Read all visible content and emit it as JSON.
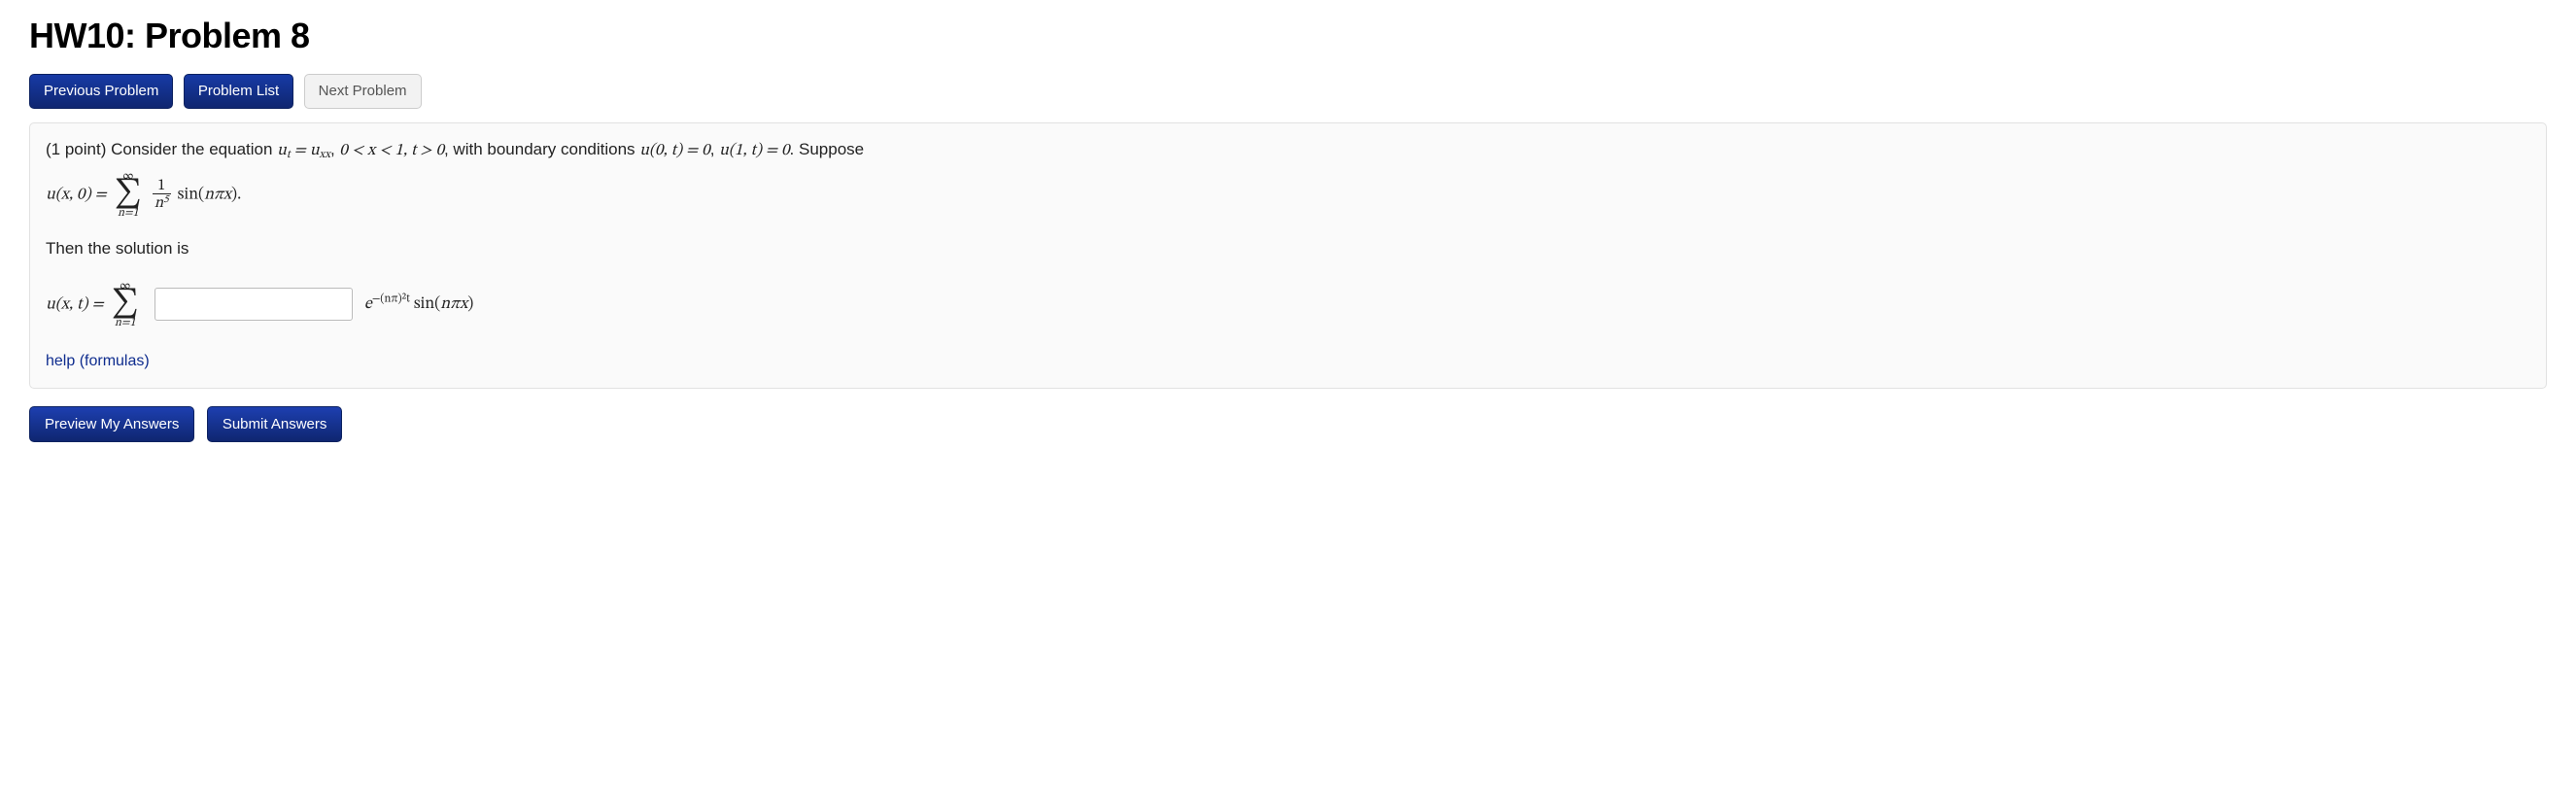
{
  "header": {
    "title": "HW10: Problem 8"
  },
  "nav": {
    "prev": "Previous Problem",
    "list": "Problem List",
    "next": "Next Problem"
  },
  "problem": {
    "points_prefix": "(1 point) ",
    "intro1": "Consider the equation ",
    "eq_pde": "uₜ = uₓₓ",
    "eq_comma": ", ",
    "domain": "0 < x < 1, t > 0",
    "intro2": ", with boundary conditions ",
    "bc1": "u(0, t) = 0",
    "bc_sep": ", ",
    "bc2": "u(1, t) = 0",
    "intro3": ". Suppose",
    "ic_lhs": "u(x, 0) = ",
    "sum_top": "∞",
    "sum_bottom": "n=1",
    "frac_num": "1",
    "frac_den": "n⁵",
    "ic_sin": "sin(nπx).",
    "then": "Then the solution is",
    "sol_lhs": "u(x, t) = ",
    "sol_tail_exp_pre": "e",
    "sol_tail_exp_sup": "−(nπ)²t",
    "sol_tail_sin": " sin(nπx)",
    "help": "help (formulas)"
  },
  "actions": {
    "preview": "Preview My Answers",
    "submit": "Submit Answers"
  }
}
